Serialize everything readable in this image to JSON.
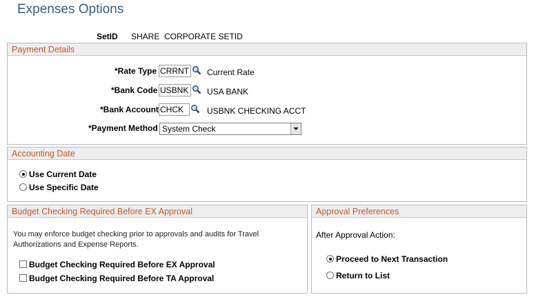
{
  "page": {
    "title": "Expenses Options"
  },
  "setid": {
    "label": "SetID",
    "code": "SHARE",
    "description": "CORPORATE SETID"
  },
  "payment_details": {
    "header": "Payment Details",
    "rate_type": {
      "label": "*Rate Type",
      "value": "CRRNT",
      "description": "Current Rate"
    },
    "bank_code": {
      "label": "*Bank Code",
      "value": "USBNK",
      "description": "USA BANK"
    },
    "bank_account": {
      "label": "*Bank Account",
      "value": "CHCK",
      "description": "USBNK CHECKING ACCT"
    },
    "payment_method": {
      "label": "*Payment Method",
      "value": "System Check"
    }
  },
  "accounting_date": {
    "header": "Accounting Date",
    "options": [
      {
        "label": "Use Current Date",
        "selected": true
      },
      {
        "label": "Use Specific Date",
        "selected": false
      }
    ]
  },
  "budget_checking": {
    "header": "Budget Checking Required Before EX Approval",
    "note_line1": "You may enforce budget checking prior to approvals and audits for Travel",
    "note_line2": "Authorizations and Expense Reports.",
    "checkboxes": [
      {
        "label": "Budget Checking Required Before EX Approval",
        "checked": false
      },
      {
        "label": "Budget Checking Required Before TA Approval",
        "checked": false
      }
    ]
  },
  "approval_preferences": {
    "header": "Approval Preferences",
    "action_label": "After Approval Action:",
    "options": [
      {
        "label": "Proceed to Next Transaction",
        "selected": true
      },
      {
        "label": "Return to List",
        "selected": false
      }
    ]
  },
  "colors": {
    "title": "#37598c",
    "section_header_text": "#c1582b",
    "section_header_bg": "#eeeeee"
  },
  "icons": {
    "lookup": "magnifier-icon",
    "dropdown": "chevron-down-icon"
  }
}
